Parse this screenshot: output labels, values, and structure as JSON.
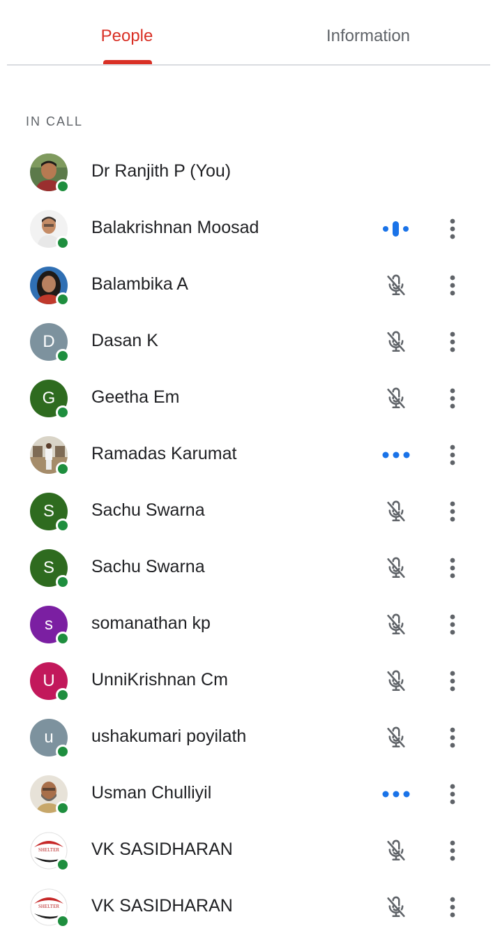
{
  "tabs": [
    {
      "label": "People",
      "active": true
    },
    {
      "label": "Information",
      "active": false
    }
  ],
  "colors": {
    "accent": "#d93025",
    "presence": "#1e8e3e",
    "speaking": "#1a73e8",
    "icon_gray": "#5f6368"
  },
  "section": {
    "label": "IN CALL"
  },
  "participants": [
    {
      "name": "Dr Ranjith P (You)",
      "avatar": {
        "type": "photo",
        "icon": "man-portrait-photo"
      },
      "status": "none",
      "has_menu": false
    },
    {
      "name": "Balakrishnan Moosad",
      "avatar": {
        "type": "photo",
        "icon": "man-portrait-photo"
      },
      "status": "speaking",
      "has_menu": true
    },
    {
      "name": "Balambika A",
      "avatar": {
        "type": "photo",
        "icon": "woman-portrait-photo"
      },
      "status": "muted",
      "has_menu": true
    },
    {
      "name": "Dasan K",
      "avatar": {
        "type": "initial",
        "letter": "D",
        "color": "#7d929e"
      },
      "status": "muted",
      "has_menu": true
    },
    {
      "name": "Geetha Em",
      "avatar": {
        "type": "initial",
        "letter": "G",
        "color": "#2e6b1f"
      },
      "status": "muted",
      "has_menu": true
    },
    {
      "name": "Ramadas Karumat",
      "avatar": {
        "type": "photo",
        "icon": "standing-person-photo"
      },
      "status": "unmuted",
      "has_menu": true
    },
    {
      "name": "Sachu Swarna",
      "avatar": {
        "type": "initial",
        "letter": "S",
        "color": "#2e6b1f"
      },
      "status": "muted",
      "has_menu": true
    },
    {
      "name": "Sachu Swarna",
      "avatar": {
        "type": "initial",
        "letter": "S",
        "color": "#2e6b1f"
      },
      "status": "muted",
      "has_menu": true
    },
    {
      "name": "somanathan kp",
      "avatar": {
        "type": "initial",
        "letter": "s",
        "color": "#7b1fa2"
      },
      "status": "muted",
      "has_menu": true
    },
    {
      "name": "UnniKrishnan Cm",
      "avatar": {
        "type": "initial",
        "letter": "U",
        "color": "#c2185b"
      },
      "status": "muted",
      "has_menu": true
    },
    {
      "name": "ushakumari poyilath",
      "avatar": {
        "type": "initial",
        "letter": "u",
        "color": "#7d929e"
      },
      "status": "muted",
      "has_menu": true
    },
    {
      "name": "Usman Chulliyil",
      "avatar": {
        "type": "photo",
        "icon": "bearded-man-photo"
      },
      "status": "unmuted",
      "has_menu": true
    },
    {
      "name": "VK SASIDHARAN",
      "avatar": {
        "type": "logo",
        "icon": "shelter-logo",
        "text": "SHELTER"
      },
      "status": "muted",
      "has_menu": true
    },
    {
      "name": "VK SASIDHARAN",
      "avatar": {
        "type": "logo",
        "icon": "shelter-logo",
        "text": "SHELTER"
      },
      "status": "muted",
      "has_menu": true
    }
  ]
}
